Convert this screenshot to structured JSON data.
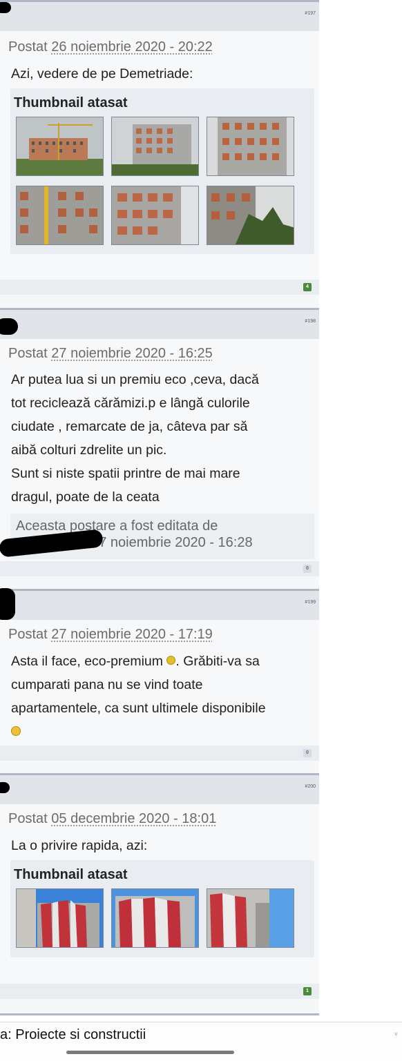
{
  "posts": [
    {
      "number": "#197",
      "posted_prefix": "Postat",
      "date": "26 noiembrie 2020 - 20:22",
      "text_lines": [
        "Azi, vedere de pe Demetriade:"
      ],
      "attachment_title": "Thumbnail atasat",
      "reputation": "4"
    },
    {
      "number": "#198",
      "posted_prefix": "Postat",
      "date": "27 noiembrie 2020 - 16:25",
      "text_lines": [
        "Ar putea lua si un premiu eco ,ceva, dacă",
        "tot reciclează cărămizi.p e lângă culorile",
        "ciudate , remarcate de ja, câteva par să",
        "aibă colturi zdrelite un pic.",
        "Sunt si niste spatii printre de mai mare",
        "dragul, poate de la ceata"
      ],
      "edit_line1": "Aceasta postare a fost editata de",
      "edit_line2": ": 27 noiembrie 2020 - 16:28",
      "reputation": "0"
    },
    {
      "number": "#199",
      "posted_prefix": "Postat",
      "date": "27 noiembrie 2020 - 17:19",
      "text_line1_a": "Asta il face, eco-premium ",
      "text_line1_b": ". Grăbiti-va sa",
      "text_line2": "cumparati pana nu se vind toate",
      "text_line3": "apartamentele, ca sunt ultimele disponibile",
      "reputation": "0"
    },
    {
      "number": "#200",
      "posted_prefix": "Postat",
      "date": "05 decembrie 2020 - 18:01",
      "text_lines": [
        "La o privire rapida, azi:"
      ],
      "attachment_title": "Thumbnail atasat",
      "reputation": "1"
    }
  ],
  "bottom_bar": {
    "breadcrumb": "a: Proiecte si constructii",
    "chevron": "˅"
  }
}
